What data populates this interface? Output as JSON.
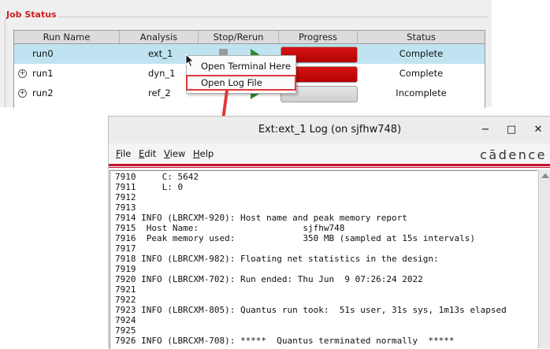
{
  "job_status": {
    "title": "Job Status",
    "columns": [
      "Run Name",
      "Analysis",
      "Stop/Rerun",
      "Progress",
      "Status"
    ],
    "rows": [
      {
        "name": "run0",
        "analysis": "ext_1",
        "progress": 1.0,
        "status": "Complete"
      },
      {
        "name": "run1",
        "analysis": "dyn_1",
        "progress": 1.0,
        "status": "Complete"
      },
      {
        "name": "run2",
        "analysis": "ref_2",
        "progress": 0.0,
        "status": "Incomplete"
      }
    ],
    "expander_glyph": "+"
  },
  "context_menu": {
    "items": [
      "Open Terminal Here",
      "Open Log File"
    ],
    "highlight_color": "#e0393b"
  },
  "log_window": {
    "title": "Ext:ext_1 Log (on sjfhw748)",
    "controls": {
      "minimize": "−",
      "maximize": "□",
      "close": "✕"
    },
    "menu": [
      {
        "key": "F",
        "rest": "ile"
      },
      {
        "key": "E",
        "rest": "dit"
      },
      {
        "key": "V",
        "rest": "iew"
      },
      {
        "key": "H",
        "rest": "elp"
      }
    ],
    "brand": "cādence",
    "brand_color": "#c8102e",
    "lines": [
      "7910     C: 5642",
      "7911     L: 0",
      "7912",
      "7913",
      "7914 INFO (LBRCXM-920): Host name and peak memory report",
      "7915  Host Name:                    sjfhw748",
      "7916  Peak memory used:             350 MB (sampled at 15s intervals)",
      "7917",
      "7918 INFO (LBRCXM-982): Floating net statistics in the design:",
      "7919",
      "7920 INFO (LBRCXM-702): Run ended: Thu Jun  9 07:26:24 2022",
      "7921",
      "7922",
      "7923 INFO (LBRCXM-805): Quantus run took:  51s user, 31s sys, 1m13s elapsed",
      "7924",
      "7925",
      "7926 INFO (LBRCXM-708): *****  Quantus terminated normally  *****"
    ]
  }
}
